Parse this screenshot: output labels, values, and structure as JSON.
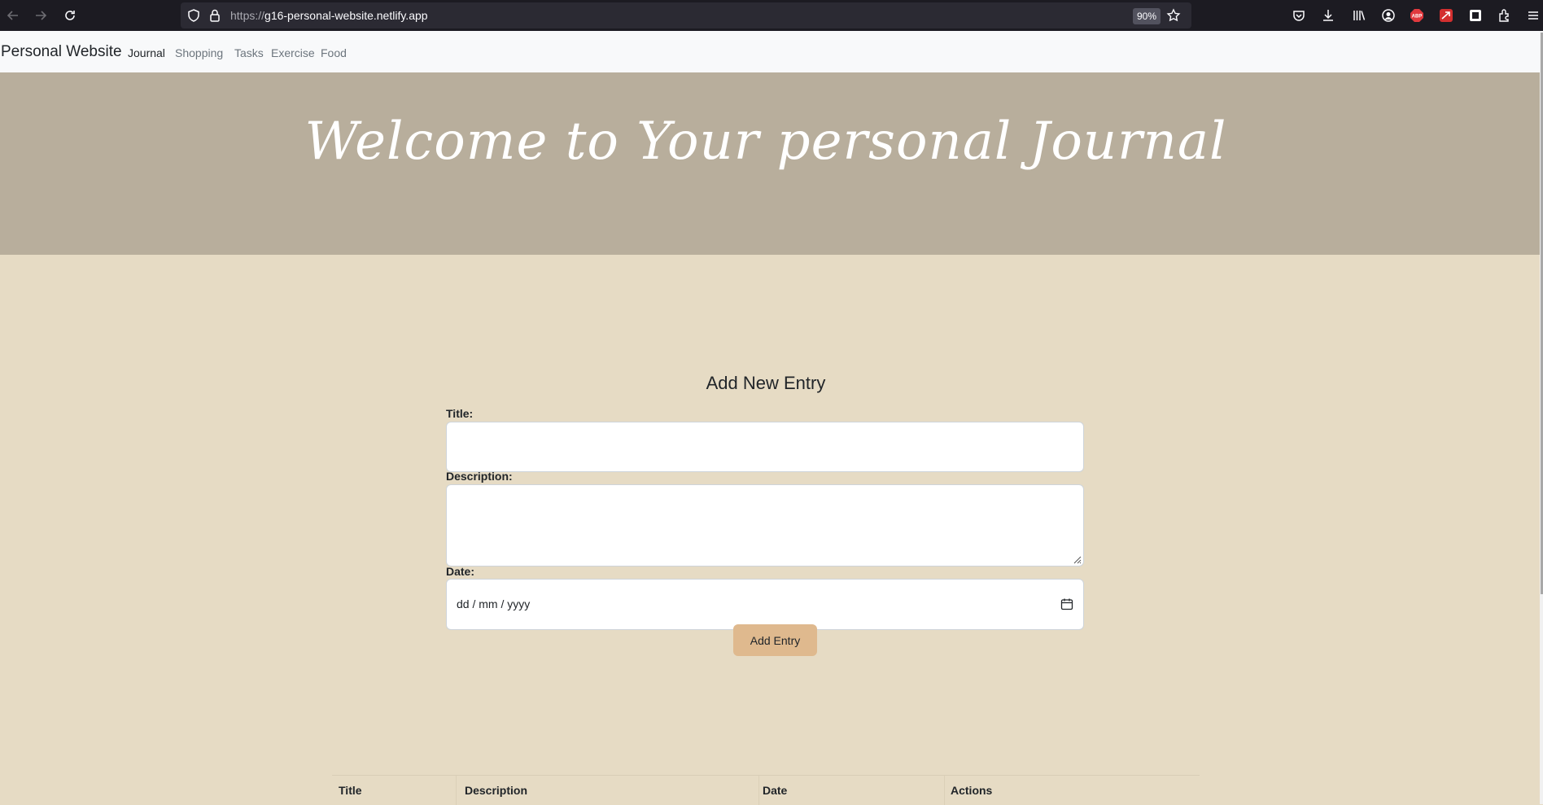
{
  "browser": {
    "url_scheme": "https://",
    "url_host": "g16-personal-website.netlify.app",
    "zoom": "90%",
    "icons": [
      "back-arrow-icon",
      "forward-arrow-icon",
      "reload-icon",
      "shield-icon",
      "lock-icon",
      "star-icon",
      "pocket-icon",
      "download-icon",
      "library-icon",
      "account-icon",
      "adblock-icon",
      "extension-red-icon",
      "extension-dark-icon",
      "extensions-icon",
      "menu-icon"
    ],
    "adblock_label": "ABP"
  },
  "navbar": {
    "brand": "Personal Website",
    "links": [
      {
        "label": "Journal",
        "active": true
      },
      {
        "label": "Shopping",
        "active": false
      },
      {
        "label": "Tasks",
        "active": false
      },
      {
        "label": "Exercise",
        "active": false
      },
      {
        "label": "Food",
        "active": false
      }
    ]
  },
  "hero": {
    "title": "Welcome to Your personal Journal",
    "background": "#b8ae9c"
  },
  "form": {
    "heading": "Add New Entry",
    "title_label": "Title:",
    "title_value": "",
    "description_label": "Description:",
    "description_value": "",
    "date_label": "Date:",
    "date_placeholder": "dd / mm / yyyy",
    "submit_label": "Add Entry",
    "button_color": "#dfb98e"
  },
  "table": {
    "columns": [
      "Title",
      "Description",
      "Date",
      "Actions"
    ],
    "rows": []
  },
  "colors": {
    "page_background": "#e6dbc4",
    "hero_background": "#b8ae9c"
  }
}
